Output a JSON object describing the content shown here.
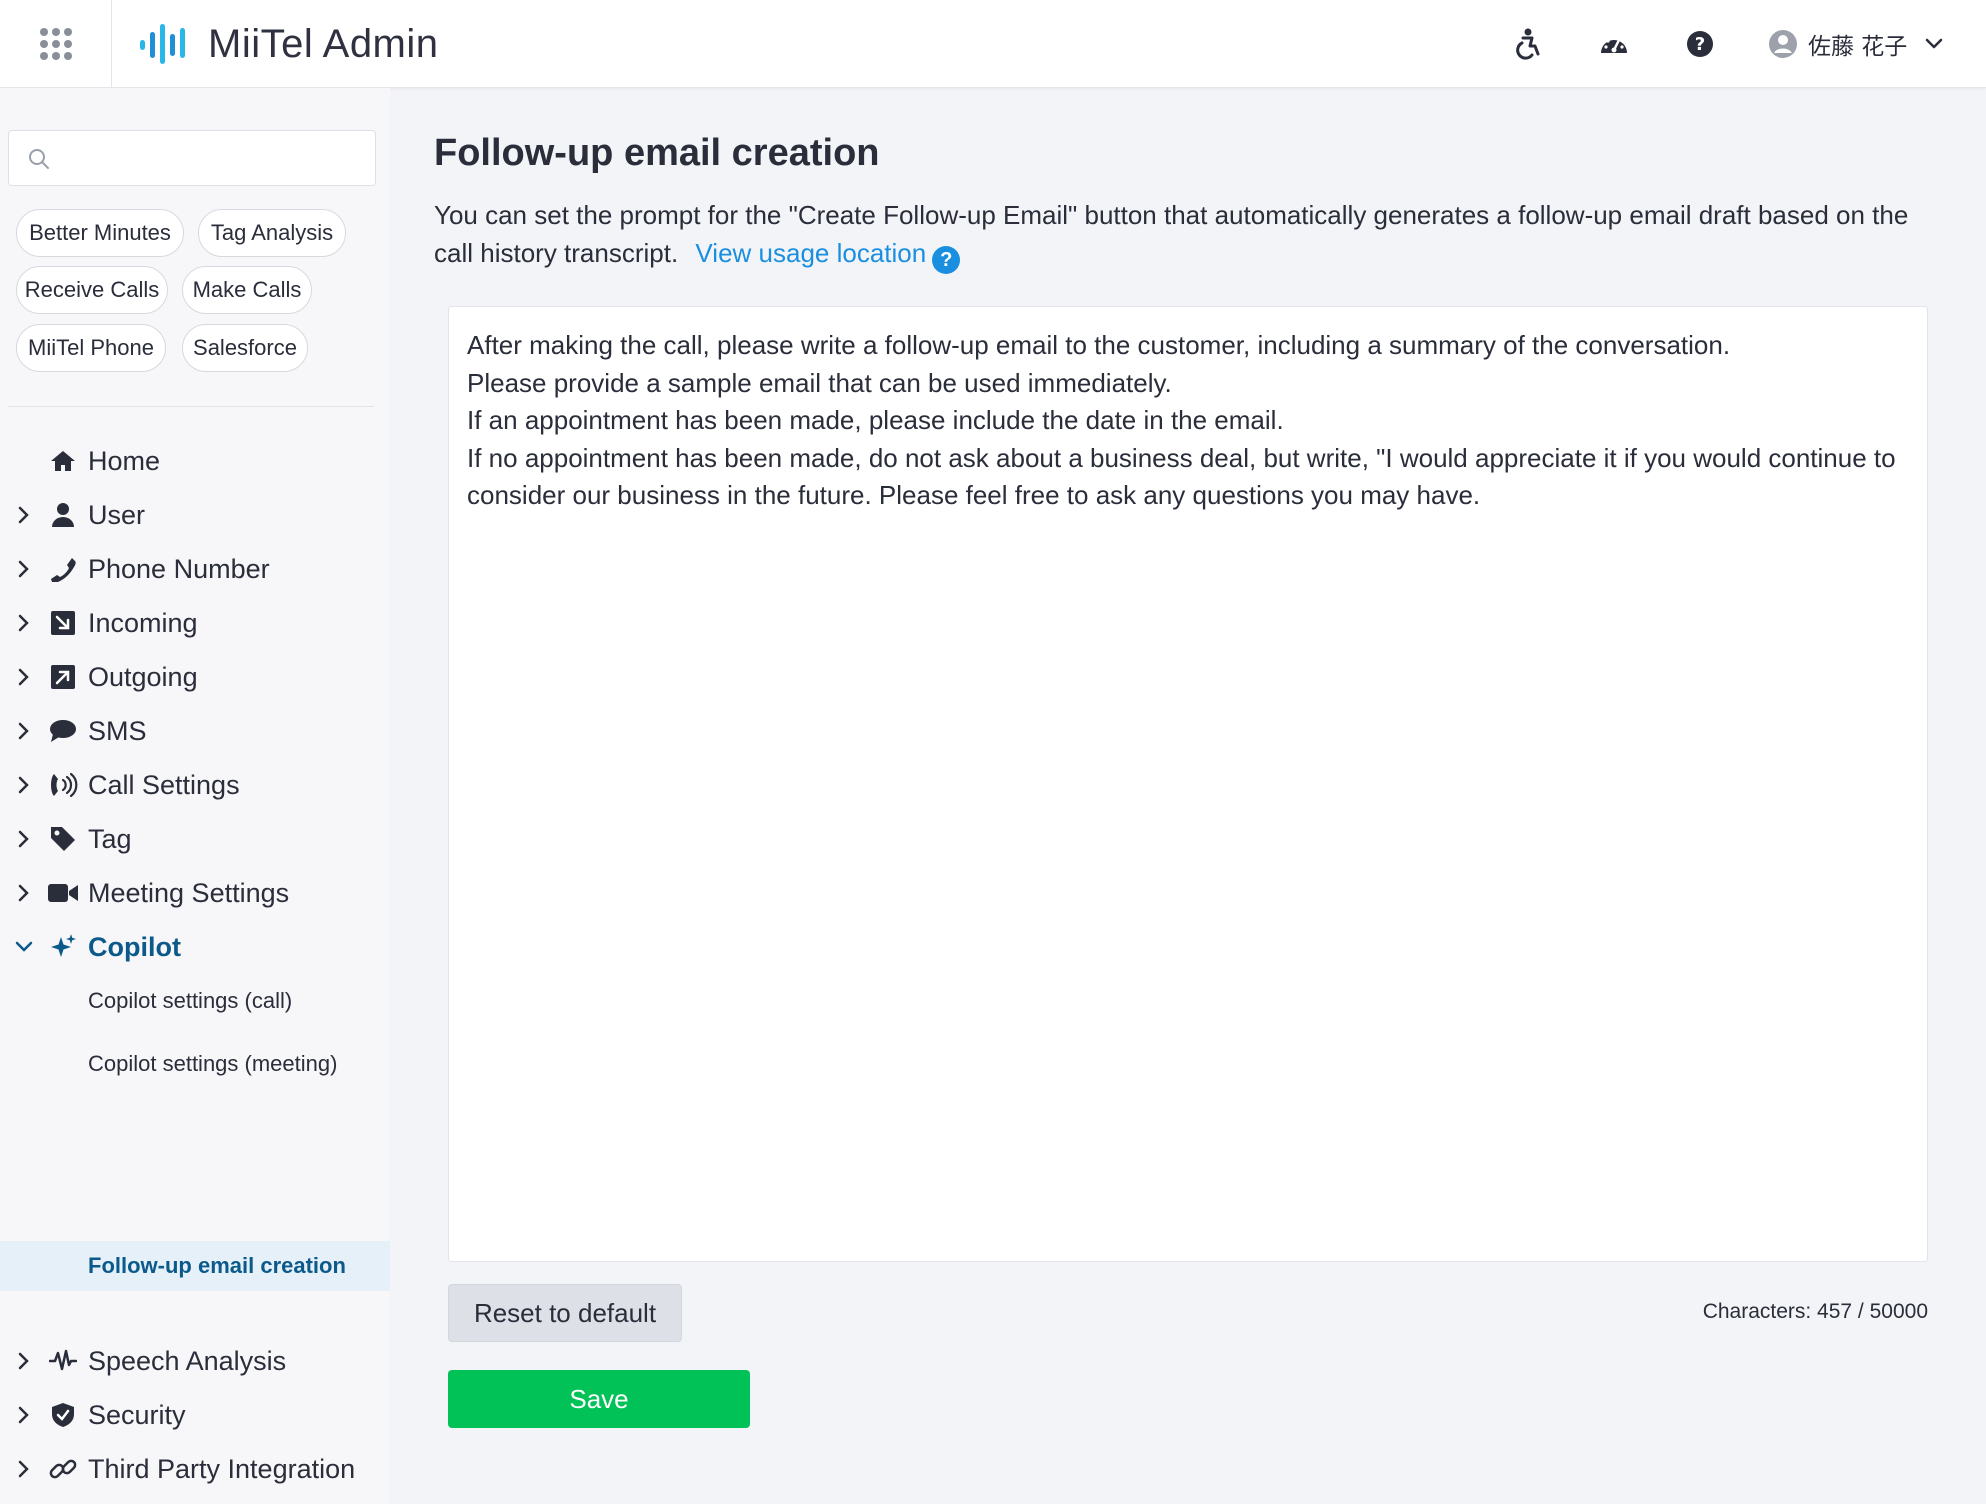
{
  "header": {
    "app_title": "MiiTel Admin",
    "user_name": "佐藤 花子",
    "icons": [
      "apps-grid-icon",
      "accessibility-icon",
      "dashboard-icon",
      "help-icon",
      "user-avatar-icon",
      "chevron-down-icon"
    ]
  },
  "sidebar": {
    "search_placeholder": "",
    "chips": [
      "Better Minutes",
      "Tag Analysis",
      "Receive Calls",
      "Make Calls",
      "MiiTel Phone",
      "Salesforce"
    ],
    "nav": [
      {
        "label": "Home",
        "icon": "home-icon"
      },
      {
        "label": "User",
        "icon": "user-icon"
      },
      {
        "label": "Phone Number",
        "icon": "phone-icon"
      },
      {
        "label": "Incoming",
        "icon": "incoming-icon"
      },
      {
        "label": "Outgoing",
        "icon": "outgoing-icon"
      },
      {
        "label": "SMS",
        "icon": "sms-icon"
      },
      {
        "label": "Call Settings",
        "icon": "call-settings-icon"
      },
      {
        "label": "Tag",
        "icon": "tag-icon"
      },
      {
        "label": "Meeting Settings",
        "icon": "video-icon"
      },
      {
        "label": "Copilot",
        "icon": "sparkle-icon"
      },
      {
        "label": "Speech Analysis",
        "icon": "waveform-icon"
      },
      {
        "label": "Security",
        "icon": "shield-icon"
      },
      {
        "label": "Third Party Integration",
        "icon": "link-icon"
      }
    ],
    "copilot_sub": [
      "Copilot settings (call)",
      "Copilot settings (meeting)",
      "Follow-up email creation"
    ]
  },
  "main": {
    "title": "Follow-up email creation",
    "description": "You can set the prompt for the \"Create Follow-up Email\" button that automatically generates a follow-up email draft based on the call history transcript.",
    "usage_link": "View usage location",
    "prompt_text": "After making the call, please write a follow-up email to the customer, including a summary of the conversation.\nPlease provide a sample email that can be used immediately.\nIf an appointment has been made, please include the date in the email.\nIf no appointment has been made, do not ask about a business deal, but write, \"I would appreciate it if you would continue to consider our business in the future. Please feel free to ask any questions you may have.",
    "reset_label": "Reset to default",
    "char_count": "Characters: 457 / 50000",
    "save_label": "Save"
  },
  "colors": {
    "accent": "#0b5a8a",
    "link": "#1a8fe0",
    "save": "#00c257",
    "selected_bg": "#e6f0f9"
  }
}
